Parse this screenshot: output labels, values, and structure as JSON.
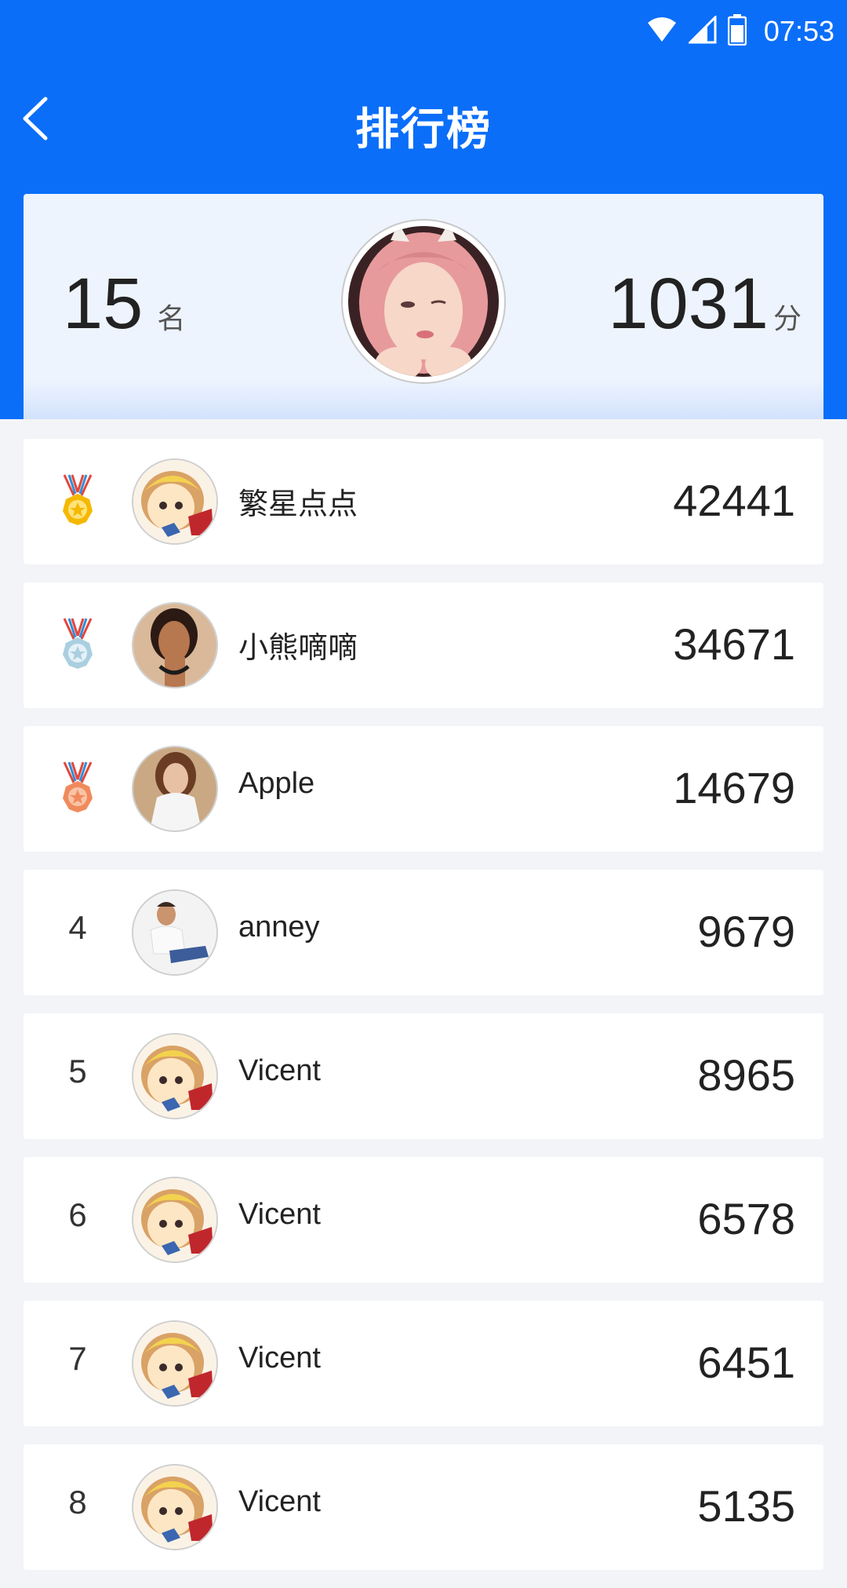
{
  "status_bar": {
    "time": "07:53",
    "icons": [
      "wifi-icon",
      "signal-icon",
      "battery-icon"
    ]
  },
  "header": {
    "title": "排行榜",
    "back_icon": "chevron-left-icon"
  },
  "me": {
    "rank": "15",
    "rank_unit": "名",
    "score": "1031",
    "score_unit": "分"
  },
  "ranking": [
    {
      "rank": "1",
      "badge": "gold-medal-icon",
      "name": "繁星点点",
      "score": "42441",
      "avatar": "cartoon"
    },
    {
      "rank": "2",
      "badge": "silver-medal-icon",
      "name": "小熊嘀嘀",
      "score": "34671",
      "avatar": "woman"
    },
    {
      "rank": "3",
      "badge": "bronze-medal-icon",
      "name": "Apple",
      "score": "14679",
      "avatar": "woman2"
    },
    {
      "rank": "4",
      "badge": null,
      "name": "anney",
      "score": "9679",
      "avatar": "man"
    },
    {
      "rank": "5",
      "badge": null,
      "name": "Vicent",
      "score": "8965",
      "avatar": "cartoon"
    },
    {
      "rank": "6",
      "badge": null,
      "name": "Vicent",
      "score": "6578",
      "avatar": "cartoon"
    },
    {
      "rank": "7",
      "badge": null,
      "name": "Vicent",
      "score": "6451",
      "avatar": "cartoon"
    },
    {
      "rank": "8",
      "badge": null,
      "name": "Vicent",
      "score": "5135",
      "avatar": "cartoon"
    }
  ],
  "colors": {
    "primary": "#0a6ef9",
    "gold": "#f5b800",
    "silver": "#9fc4d6",
    "bronze": "#f08a5d"
  }
}
